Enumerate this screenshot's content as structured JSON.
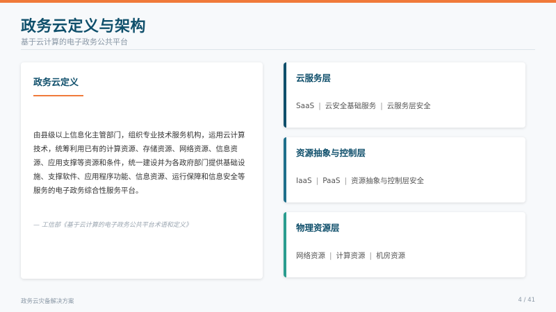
{
  "header": {
    "title": "政务云定义与架构",
    "subtitle": "基于云计算的电子政务公共平台"
  },
  "definition": {
    "title": "政务云定义",
    "body": "由县级以上信息化主管部门，组织专业技术服务机构，运用云计算技术，统筹利用已有的计算资源、存储资源、网络资源、信息资源、应用支撑等资源和条件，统一建设并为各政府部门提供基础设施、支撑软件、应用程序功能、信息资源、运行保障和信息安全等服务的电子政务综合性服务平台。",
    "source": "— 工信部《基于云计算的电子政务公共平台术语和定义》"
  },
  "layers": [
    {
      "title": "云服务层",
      "items": [
        "SaaS",
        "云安全基础服务",
        "云服务层安全"
      ],
      "accent": "#0f4f6b"
    },
    {
      "title": "资源抽象与控制层",
      "items": [
        "IaaS",
        "PaaS",
        "资源抽象与控制层安全"
      ],
      "accent": "#1f6f8b"
    },
    {
      "title": "物理资源层",
      "items": [
        "网络资源",
        "计算资源",
        "机房资源"
      ],
      "accent": "#2a9d8f"
    }
  ],
  "footer": {
    "left": "政务云灾备解决方案",
    "page": "4 / 41"
  },
  "colors": {
    "accent_orange": "#f07a3a",
    "primary_dark": "#0f4f6b"
  }
}
